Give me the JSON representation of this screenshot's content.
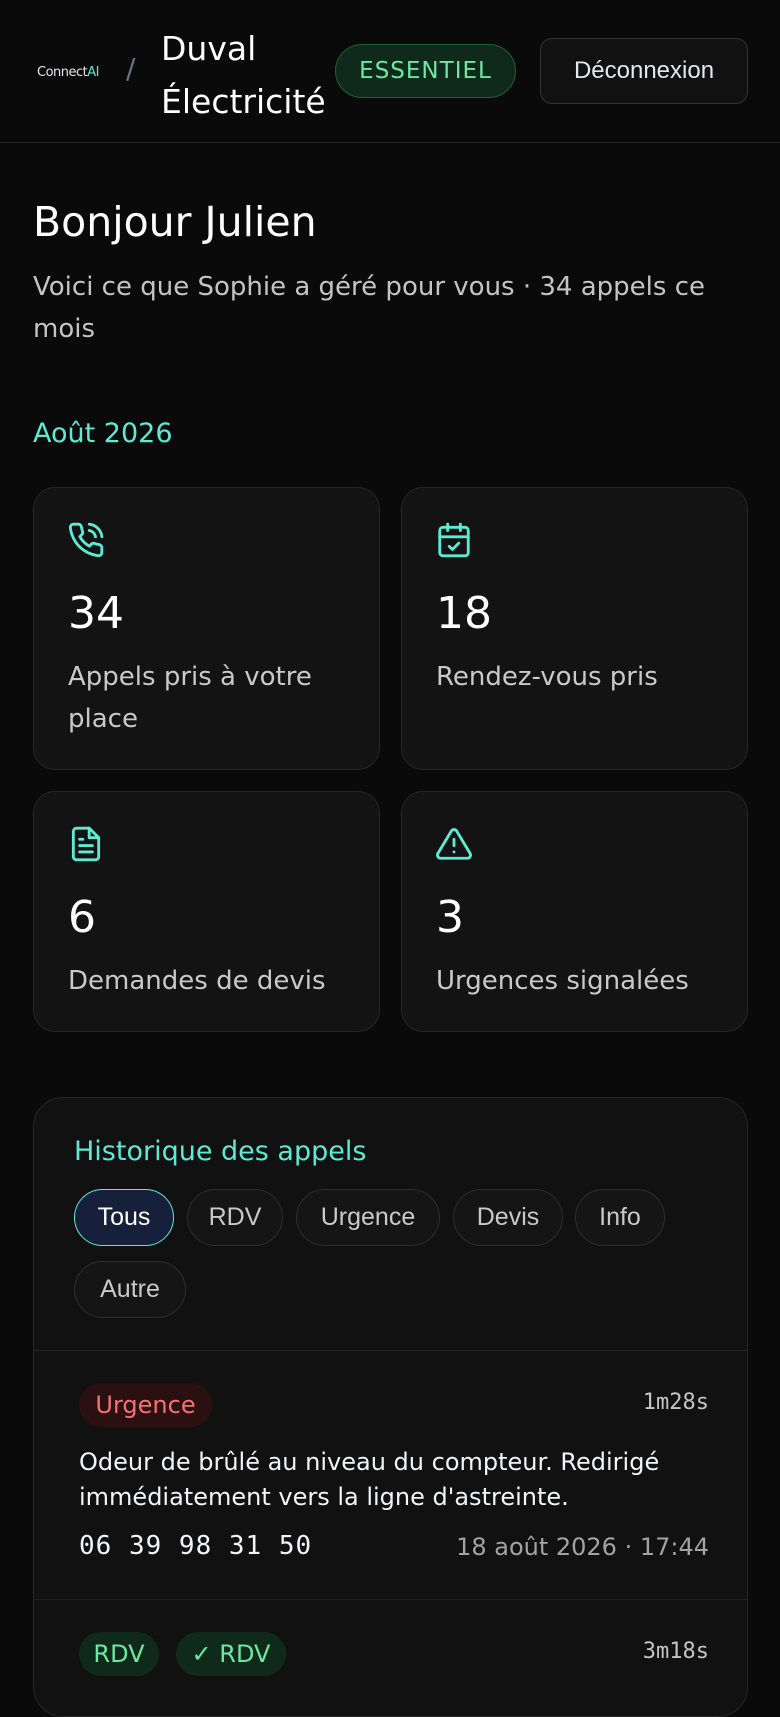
{
  "header": {
    "logo_text": "Connect",
    "logo_accent": "AI",
    "separator": "/",
    "company": "Duval Électricité",
    "plan": "ESSENTIEL",
    "logout": "Déconnexion"
  },
  "greeting": "Bonjour Julien",
  "subtitle": "Voici ce que Sophie a géré pour vous · 34 appels ce mois",
  "month": "Août 2026",
  "stats": [
    {
      "icon": "phone-call-icon",
      "value": "34",
      "label": "Appels pris à votre place"
    },
    {
      "icon": "calendar-check-icon",
      "value": "18",
      "label": "Rendez-vous pris"
    },
    {
      "icon": "file-text-icon",
      "value": "6",
      "label": "Demandes de devis"
    },
    {
      "icon": "alert-triangle-icon",
      "value": "3",
      "label": "Urgences signalées"
    }
  ],
  "history": {
    "title": "Historique des appels",
    "filters": [
      "Tous",
      "RDV",
      "Urgence",
      "Devis",
      "Info",
      "Autre"
    ],
    "active_filter": "Tous",
    "calls": [
      {
        "tags": [
          "Urgence"
        ],
        "duration": "1m28s",
        "summary": "Odeur de brûlé au niveau du compteur. Redirigé immédiatement vers la ligne d'astreinte.",
        "phone": "06 39 98 31 50",
        "datetime": "18 août 2026 · 17:44"
      },
      {
        "tags": [
          "RDV",
          "✓ RDV"
        ],
        "duration": "3m18s",
        "summary": "",
        "phone": "",
        "datetime": ""
      }
    ]
  },
  "colors": {
    "accent": "#5eead4",
    "background": "#0a0a0a",
    "card": "#131313",
    "urgent": "#f87171",
    "success": "#6ee7a0"
  }
}
